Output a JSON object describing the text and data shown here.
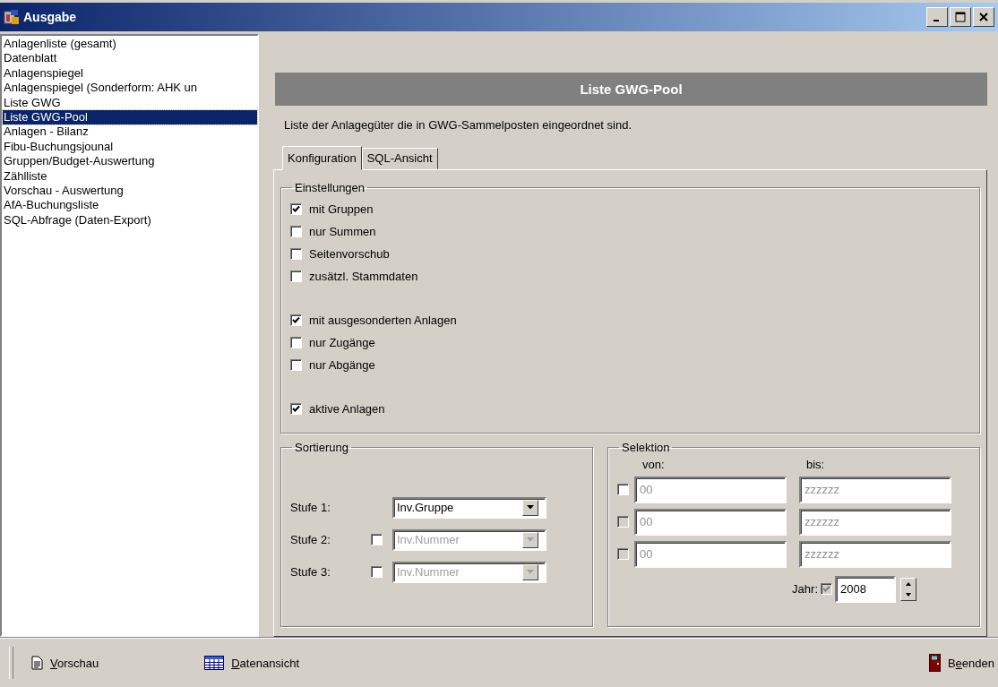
{
  "window": {
    "title": "Ausgabe"
  },
  "report_list": [
    {
      "label": "Anlagenliste (gesamt)",
      "selected": false
    },
    {
      "label": "Datenblatt",
      "selected": false
    },
    {
      "label": "Anlagenspiegel",
      "selected": false
    },
    {
      "label": "Anlagenspiegel (Sonderform: AHK un",
      "selected": false
    },
    {
      "label": "Liste GWG",
      "selected": false
    },
    {
      "label": "Liste GWG-Pool",
      "selected": true
    },
    {
      "label": "Anlagen - Bilanz",
      "selected": false
    },
    {
      "label": "Fibu-Buchungsjounal",
      "selected": false
    },
    {
      "label": "Gruppen/Budget-Auswertung",
      "selected": false
    },
    {
      "label": "Zählliste",
      "selected": false
    },
    {
      "label": "Vorschau - Auswertung",
      "selected": false
    },
    {
      "label": "AfA-Buchungsliste",
      "selected": false
    },
    {
      "label": "SQL-Abfrage (Daten-Export)",
      "selected": false
    }
  ],
  "panel": {
    "title": "Liste GWG-Pool",
    "description": "Liste der Anlagegüter die in GWG-Sammelposten eingeordnet sind."
  },
  "tabs": [
    {
      "label": "Konfiguration",
      "selected": true
    },
    {
      "label": "SQL-Ansicht",
      "selected": false
    }
  ],
  "settings": {
    "legend": "Einstellungen",
    "groups": [
      [
        {
          "label": "mit Gruppen",
          "checked": true
        },
        {
          "label": "nur Summen",
          "checked": false
        },
        {
          "label": "Seitenvorschub",
          "checked": false
        },
        {
          "label": "zusätzl. Stammdaten",
          "checked": false
        }
      ],
      [
        {
          "label": "mit ausgesonderten Anlagen",
          "checked": true
        },
        {
          "label": "nur Zugänge",
          "checked": false
        },
        {
          "label": "nur Abgänge",
          "checked": false
        }
      ],
      [
        {
          "label": "aktive Anlagen",
          "checked": true
        }
      ]
    ]
  },
  "sorting": {
    "legend": "Sortierung",
    "levels": [
      {
        "kind": "fixed",
        "label": "Stufe 1:",
        "value": "Inv.Gruppe",
        "disabled": false
      },
      {
        "kind": "optional",
        "label": "Stufe 2:",
        "checked": false,
        "value": "Inv.Nummer",
        "disabled": true
      },
      {
        "kind": "optional",
        "label": "Stufe 3:",
        "checked": false,
        "value": "Inv.Nummer",
        "disabled": true
      }
    ]
  },
  "selection": {
    "legend": "Selektion",
    "from_label": "von:",
    "to_label": "bis:",
    "rows": [
      {
        "checked": false,
        "checkbox_disabled": false,
        "from": "00",
        "to": "zzzzzz",
        "fields_disabled": true
      },
      {
        "checked": false,
        "checkbox_disabled": true,
        "from": "00",
        "to": "zzzzzz",
        "fields_disabled": true
      },
      {
        "checked": false,
        "checkbox_disabled": true,
        "from": "00",
        "to": "zzzzzz",
        "fields_disabled": true
      }
    ],
    "year": {
      "label": "Jahr:",
      "checked": true,
      "checkbox_disabled": true,
      "value": "2008"
    }
  },
  "toolbar": [
    {
      "kind": "preview",
      "key": "V",
      "rest": "orschau"
    },
    {
      "kind": "dataview",
      "key": "D",
      "rest": "atenansicht"
    },
    {
      "kind": "exit",
      "lead": "B",
      "key": "e",
      "rest": "enden"
    }
  ]
}
